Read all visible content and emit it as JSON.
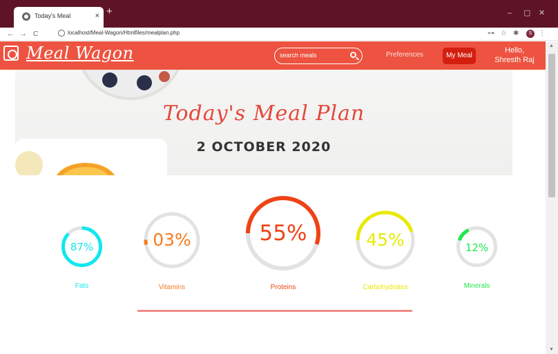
{
  "browser": {
    "tab_title": "Today's Meal",
    "tab_close": "×",
    "new_tab": "+",
    "url": "localhost/Meal-Wagon/Htmlfiles/mealplan.php",
    "back": "←",
    "forward": "→",
    "reload": "C",
    "minimize": "–",
    "maximize": "▢",
    "close": "✕",
    "key_icon": "⊶",
    "star_icon": "☆",
    "ext_icon": "✱",
    "profile_initial": "S",
    "menu_icon": "⋮"
  },
  "header": {
    "brand": "Meal Wagon",
    "search_placeholder": "search meals",
    "nav_preferences": "Preferences",
    "nav_my_meal": "My Meal",
    "greeting_line1": "Hello,",
    "greeting_line2": "Shresth Raj",
    "accent_color": "#ed5340"
  },
  "banner": {
    "title": "Today's Meal Plan",
    "date": "2 OCTOBER 2020"
  },
  "nutrients": [
    {
      "label": "Fats",
      "percent_text": "87%",
      "value": 87,
      "color": "#11e8ee"
    },
    {
      "label": "Vitamins",
      "percent_text": "03%",
      "value": 3,
      "color": "#f77b1d"
    },
    {
      "label": "Proteins",
      "percent_text": "55%",
      "value": 55,
      "color": "#ef4316"
    },
    {
      "label": "Carbohydrates",
      "percent_text": "45%",
      "value": 45,
      "color": "#e8ea00"
    },
    {
      "label": "Minerals",
      "percent_text": "12%",
      "value": 12,
      "color": "#1ee84a"
    }
  ]
}
